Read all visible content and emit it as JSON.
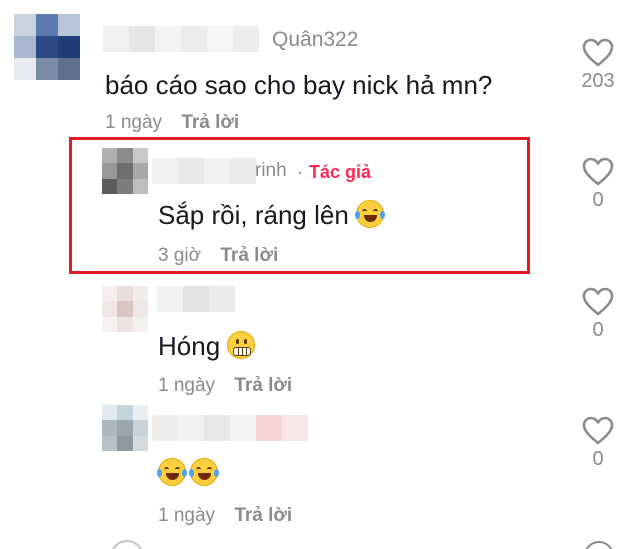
{
  "comments": [
    {
      "username": "Quân322",
      "text": "báo cáo sao cho bay nick hả mn?",
      "time": "1 ngày",
      "reply_label": "Trả lời",
      "likes": "203"
    },
    {
      "username": "rinh",
      "author_separator": "·",
      "author_tag": "Tác giả",
      "text": "Sắp rồi, ráng lên",
      "emoji": "laughing-with-tears-emoji",
      "time": "3 giờ",
      "reply_label": "Trả lời",
      "likes": "0"
    },
    {
      "username": "",
      "text": "Hóng",
      "emoji": "grimacing-emoji",
      "time": "1 ngày",
      "reply_label": "Trả lời",
      "likes": "0"
    },
    {
      "username": "",
      "text": "",
      "emoji": "laughing-with-tears-emoji x2",
      "time": "1 ngày",
      "reply_label": "Trả lời",
      "likes": "0"
    }
  ],
  "colors": {
    "author_accent": "#fe2c55",
    "highlight_border": "#e01b24",
    "muted_text": "#8a8b91"
  }
}
